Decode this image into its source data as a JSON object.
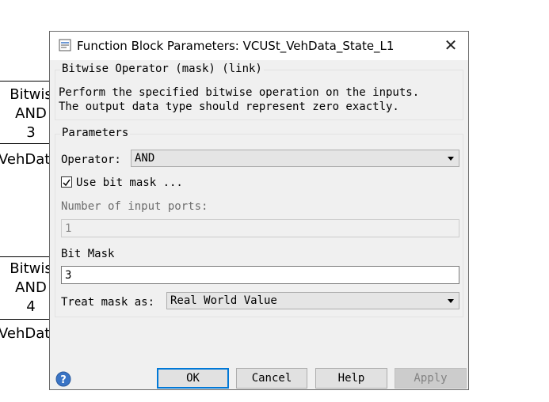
{
  "background": {
    "blocks": [
      {
        "line1": "Bitwis",
        "line2": "AND",
        "line3": "3"
      },
      {
        "line1": "Bitwis",
        "line2": "AND",
        "line3": "4"
      }
    ],
    "labels": [
      "VehDat",
      "VehDat"
    ]
  },
  "dialog": {
    "title": "Function Block Parameters: VCUSt_VehData_State_L1",
    "close_icon": "close-icon",
    "mask_group": {
      "title": "Bitwise Operator (mask) (link)",
      "description_line1": "Perform the specified bitwise operation on the inputs.",
      "description_line2": "The output data type should represent zero exactly."
    },
    "params_group": {
      "title": "Parameters",
      "operator_label": "Operator:",
      "operator_value": "AND",
      "use_bit_mask_label": "Use bit mask ...",
      "use_bit_mask_checked": true,
      "num_inputs_label": "Number of input ports:",
      "num_inputs_value": "1",
      "bit_mask_label": "Bit Mask",
      "bit_mask_value": "3",
      "treat_mask_label": "Treat mask as:",
      "treat_mask_value": "Real World Value"
    },
    "buttons": {
      "ok": "OK",
      "cancel": "Cancel",
      "help": "Help",
      "apply": "Apply"
    },
    "colors": {
      "primary_border": "#0078d7",
      "help_icon": "#3a74c5"
    }
  }
}
